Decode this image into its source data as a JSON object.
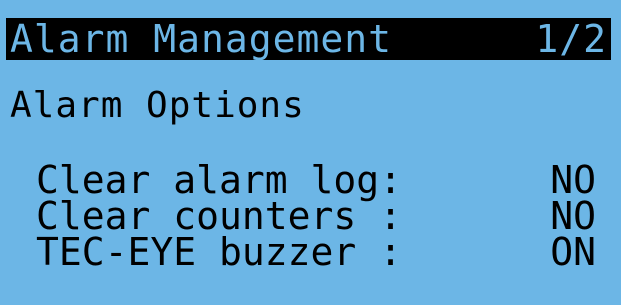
{
  "header": {
    "title": "Alarm Management",
    "page": "1/2"
  },
  "section": {
    "heading": "Alarm Options"
  },
  "options": [
    {
      "label": "Clear alarm log:",
      "value": "NO"
    },
    {
      "label": "Clear counters :",
      "value": "NO"
    },
    {
      "label": "TEC-EYE buzzer :",
      "value": "ON"
    }
  ],
  "colors": {
    "background": "#6cb6e6",
    "foreground": "#000000"
  }
}
